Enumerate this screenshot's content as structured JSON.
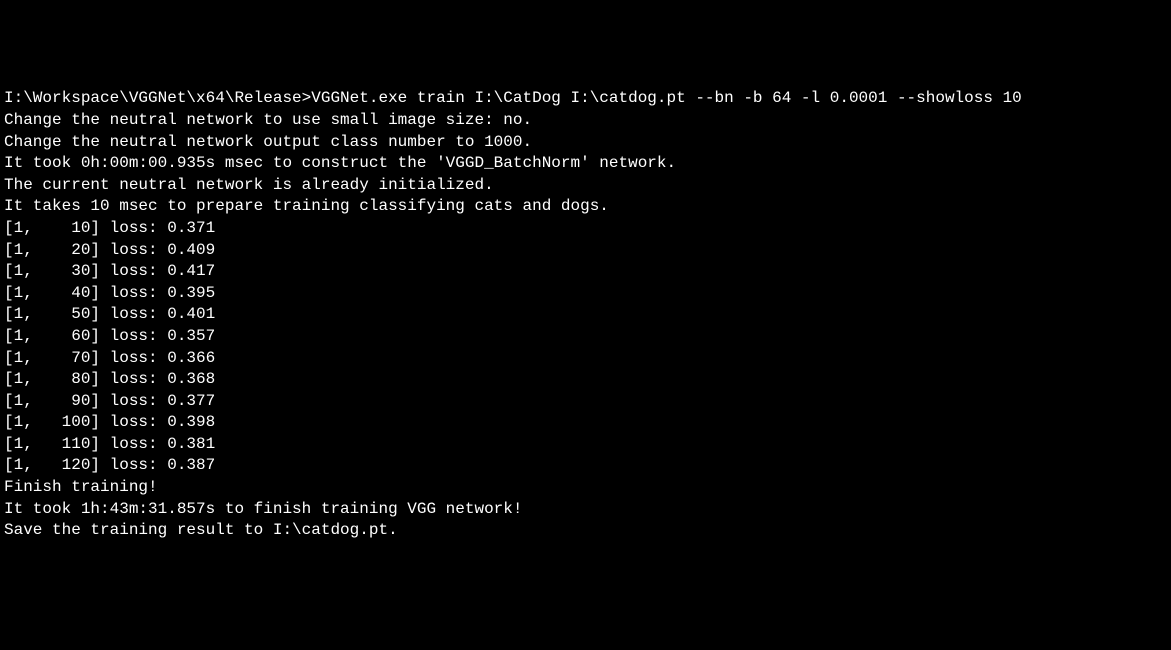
{
  "terminal": {
    "prompt_line": "I:\\Workspace\\VGGNet\\x64\\Release>VGGNet.exe train I:\\CatDog I:\\catdog.pt --bn -b 64 -l 0.0001 --showloss 10",
    "messages": [
      "Change the neutral network to use small image size: no.",
      "Change the neutral network output class number to 1000.",
      "It took 0h:00m:00.935s msec to construct the 'VGGD_BatchNorm' network.",
      "The current neutral network is already initialized.",
      "It takes 10 msec to prepare training classifying cats and dogs."
    ],
    "loss_entries": [
      {
        "epoch": 1,
        "step": 10,
        "loss": "0.371"
      },
      {
        "epoch": 1,
        "step": 20,
        "loss": "0.409"
      },
      {
        "epoch": 1,
        "step": 30,
        "loss": "0.417"
      },
      {
        "epoch": 1,
        "step": 40,
        "loss": "0.395"
      },
      {
        "epoch": 1,
        "step": 50,
        "loss": "0.401"
      },
      {
        "epoch": 1,
        "step": 60,
        "loss": "0.357"
      },
      {
        "epoch": 1,
        "step": 70,
        "loss": "0.366"
      },
      {
        "epoch": 1,
        "step": 80,
        "loss": "0.368"
      },
      {
        "epoch": 1,
        "step": 90,
        "loss": "0.377"
      },
      {
        "epoch": 1,
        "step": 100,
        "loss": "0.398"
      },
      {
        "epoch": 1,
        "step": 110,
        "loss": "0.381"
      },
      {
        "epoch": 1,
        "step": 120,
        "loss": "0.387"
      }
    ],
    "footer_messages": [
      "Finish training!",
      "It took 1h:43m:31.857s to finish training VGG network!",
      "Save the training result to I:\\catdog.pt."
    ]
  }
}
